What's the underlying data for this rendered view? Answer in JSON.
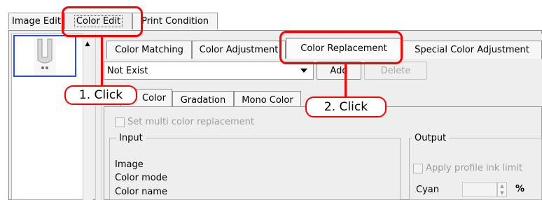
{
  "colors": {
    "annotation": "#ff0000",
    "selection": "#2a4fe0"
  },
  "top_tabs": [
    {
      "label": "Image Edit"
    },
    {
      "label": "Color Edit"
    },
    {
      "label": "Print Condition"
    }
  ],
  "thumbnail": {
    "icon": "image-thumbnail-icon"
  },
  "sub_tabs": [
    {
      "label": "Color Matching"
    },
    {
      "label": "Color Adjustment"
    },
    {
      "label": "Color Replacement"
    },
    {
      "label": "Special Color Adjustment"
    }
  ],
  "replacement_select": {
    "value": "Not Exist"
  },
  "buttons": {
    "add": "Add",
    "delete": "Delete"
  },
  "mode_tabs": [
    {
      "label": "Color"
    },
    {
      "label": "Gradation"
    },
    {
      "label": "Mono Color"
    }
  ],
  "multi_color": {
    "label": "Set multi color replacement"
  },
  "input_panel": {
    "title": "Input",
    "rows": [
      "Image",
      "Color mode",
      "Color name"
    ]
  },
  "output_panel": {
    "title": "Output",
    "apply_label": "Apply profile ink limit",
    "cyan_label": "Cyan",
    "percent": "%"
  },
  "annotations": {
    "step1": "1. Click",
    "step2": "2. Click"
  }
}
